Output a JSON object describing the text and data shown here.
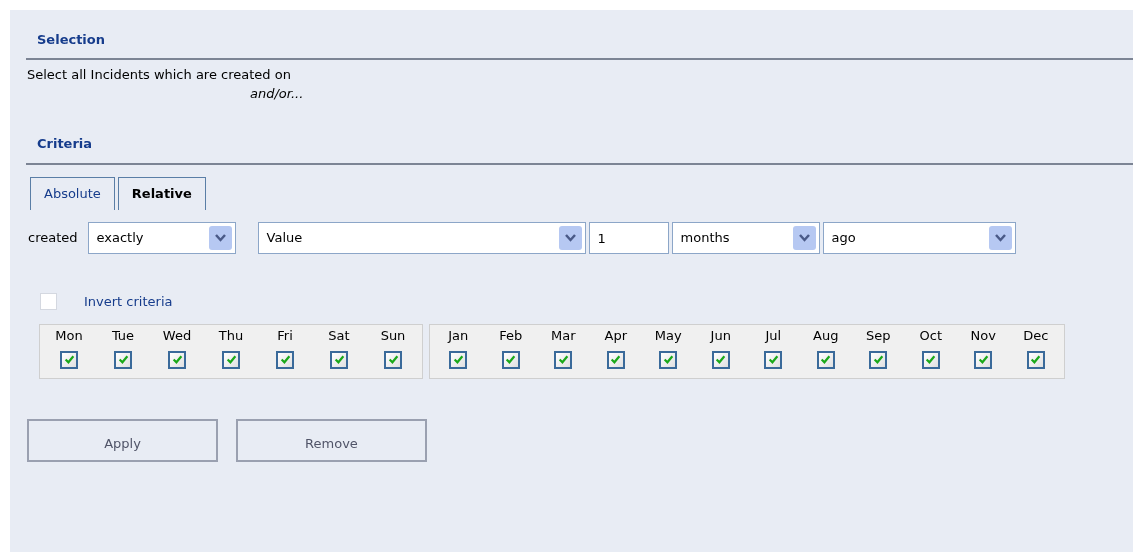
{
  "selection": {
    "heading": "Selection",
    "description": "Select all Incidents which are created on",
    "connector": "and/or..."
  },
  "criteria": {
    "heading": "Criteria",
    "tabs": [
      {
        "label": "Absolute",
        "selected": false
      },
      {
        "label": "Relative",
        "selected": true
      }
    ],
    "filter": {
      "label": "created",
      "controls": [
        {
          "kind": "select",
          "value": "exactly"
        },
        {
          "kind": "select",
          "value": "Value"
        },
        {
          "kind": "input",
          "value": "1"
        },
        {
          "kind": "select",
          "value": "months"
        },
        {
          "kind": "select",
          "value": "ago"
        }
      ]
    },
    "invert": {
      "label": "Invert criteria",
      "checked": false
    },
    "days": [
      {
        "label": "Mon",
        "checked": true
      },
      {
        "label": "Tue",
        "checked": true
      },
      {
        "label": "Wed",
        "checked": true
      },
      {
        "label": "Thu",
        "checked": true
      },
      {
        "label": "Fri",
        "checked": true
      },
      {
        "label": "Sat",
        "checked": true
      },
      {
        "label": "Sun",
        "checked": true
      }
    ],
    "months": [
      {
        "label": "Jan",
        "checked": true
      },
      {
        "label": "Feb",
        "checked": true
      },
      {
        "label": "Mar",
        "checked": true
      },
      {
        "label": "Apr",
        "checked": true
      },
      {
        "label": "May",
        "checked": true
      },
      {
        "label": "Jun",
        "checked": true
      },
      {
        "label": "Jul",
        "checked": true
      },
      {
        "label": "Aug",
        "checked": true
      },
      {
        "label": "Sep",
        "checked": true
      },
      {
        "label": "Oct",
        "checked": true
      },
      {
        "label": "Nov",
        "checked": true
      },
      {
        "label": "Dec",
        "checked": true
      }
    ]
  },
  "buttons": [
    "Apply",
    "Remove"
  ]
}
